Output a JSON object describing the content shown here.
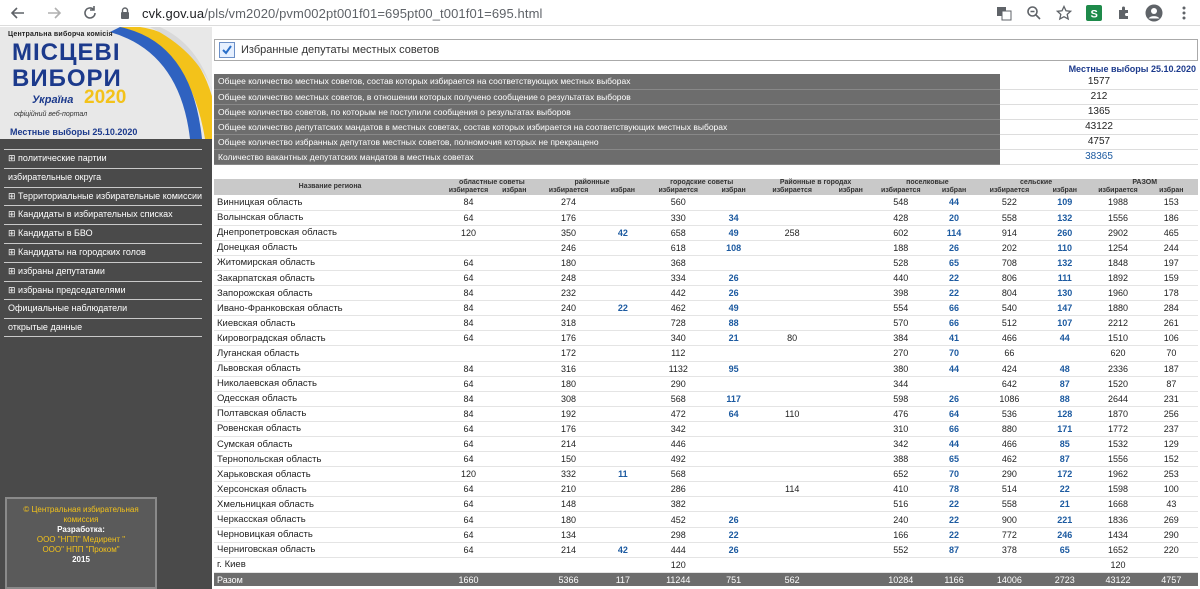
{
  "browser": {
    "url_host": "cvk.gov.ua",
    "url_path": "/pls/vm2020/pvm002pt001f01=695pt00_t001f01=695.html"
  },
  "logo": {
    "org": "Центральна виборча комісія",
    "word1": "МІСЦЕВІ",
    "word2": "ВИБОРИ",
    "country": "Україна",
    "year": "2020",
    "subtitle": "офіційний веб-портал",
    "election": "Местные выборы 25.10.2020"
  },
  "menu": [
    "⊞ политические партии",
    "избирательные округа",
    "⊞ Территориальные избирательные комиссии",
    "⊞ Кандидаты в избирательных списках",
    "⊞ Кандидаты в БВО",
    "⊞ Кандидаты на городских голов",
    "⊞ избраны депутатами",
    "⊞ избраны председателями",
    "Официальные наблюдатели",
    "открытые данные"
  ],
  "credit": {
    "line1": "© Центральная избирательная",
    "line2": "комиссия",
    "line3": "Разработка:",
    "line4": "ООО \"НПП\" Медирент \"",
    "line5": "ООО\" НПП \"Проком\"",
    "line6": "2015"
  },
  "page": {
    "title": "Избранные депутаты местных советов",
    "date_label": "Местные выборы 25.10.2020"
  },
  "summary": [
    {
      "label": "Общее количество местных советов, состав которых избирается на соответствующих местных выборах",
      "value": "1577"
    },
    {
      "label": "Общее количество местных советов, в отношении которых получено сообщение о результатах выборов",
      "value": "212"
    },
    {
      "label": "Общее количество советов, по которым не поступили сообщения о результатах выборов",
      "value": "1365"
    },
    {
      "label": "Общее количество депутатских мандатов в местных советах, состав которых избирается на соответствующих местных выборах",
      "value": "43122"
    },
    {
      "label": "Общее количество избранных депутатов местных советов, полномочия которых не прекращено",
      "value": "4757"
    },
    {
      "label": "Количество вакантных депутатских мандатов в местных советах",
      "value": "38365"
    }
  ],
  "table": {
    "header_name": "Название региона",
    "groups": [
      "областные советы",
      "районные",
      "городские советы",
      "Районные в городах",
      "поселковые",
      "сельские",
      "РАЗОМ"
    ],
    "sub_a": "избирается",
    "sub_b": "избран",
    "rows": [
      [
        "Винницкая область",
        "84",
        "",
        "274",
        "",
        "560",
        "",
        "",
        "",
        "548",
        "44",
        "522",
        "109",
        "1988",
        "153"
      ],
      [
        "Волынская область",
        "64",
        "",
        "176",
        "",
        "330",
        "34",
        "",
        "",
        "428",
        "20",
        "558",
        "132",
        "1556",
        "186"
      ],
      [
        "Днепропетровская область",
        "120",
        "",
        "350",
        "42",
        "658",
        "49",
        "258",
        "",
        "602",
        "114",
        "914",
        "260",
        "2902",
        "465"
      ],
      [
        "Донецкая область",
        "",
        "",
        "246",
        "",
        "618",
        "108",
        "",
        "",
        "188",
        "26",
        "202",
        "110",
        "1254",
        "244"
      ],
      [
        "Житомирская область",
        "64",
        "",
        "180",
        "",
        "368",
        "",
        "",
        "",
        "528",
        "65",
        "708",
        "132",
        "1848",
        "197"
      ],
      [
        "Закарпатская область",
        "64",
        "",
        "248",
        "",
        "334",
        "26",
        "",
        "",
        "440",
        "22",
        "806",
        "111",
        "1892",
        "159"
      ],
      [
        "Запорожская область",
        "84",
        "",
        "232",
        "",
        "442",
        "26",
        "",
        "",
        "398",
        "22",
        "804",
        "130",
        "1960",
        "178"
      ],
      [
        "Ивано-Франковская область",
        "84",
        "",
        "240",
        "22",
        "462",
        "49",
        "",
        "",
        "554",
        "66",
        "540",
        "147",
        "1880",
        "284"
      ],
      [
        "Киевская область",
        "84",
        "",
        "318",
        "",
        "728",
        "88",
        "",
        "",
        "570",
        "66",
        "512",
        "107",
        "2212",
        "261"
      ],
      [
        "Кировоградская область",
        "64",
        "",
        "176",
        "",
        "340",
        "21",
        "80",
        "",
        "384",
        "41",
        "466",
        "44",
        "1510",
        "106"
      ],
      [
        "Луганская область",
        "",
        "",
        "172",
        "",
        "112",
        "",
        "",
        "",
        "270",
        "70",
        "66",
        "",
        "620",
        "70"
      ],
      [
        "Львовская область",
        "84",
        "",
        "316",
        "",
        "1132",
        "95",
        "",
        "",
        "380",
        "44",
        "424",
        "48",
        "2336",
        "187"
      ],
      [
        "Николаевская область",
        "64",
        "",
        "180",
        "",
        "290",
        "",
        "",
        "",
        "344",
        "",
        "642",
        "87",
        "1520",
        "87"
      ],
      [
        "Одесская область",
        "84",
        "",
        "308",
        "",
        "568",
        "117",
        "",
        "",
        "598",
        "26",
        "1086",
        "88",
        "2644",
        "231"
      ],
      [
        "Полтавская область",
        "84",
        "",
        "192",
        "",
        "472",
        "64",
        "110",
        "",
        "476",
        "64",
        "536",
        "128",
        "1870",
        "256"
      ],
      [
        "Ровенская область",
        "64",
        "",
        "176",
        "",
        "342",
        "",
        "",
        "",
        "310",
        "66",
        "880",
        "171",
        "1772",
        "237"
      ],
      [
        "Сумская область",
        "64",
        "",
        "214",
        "",
        "446",
        "",
        "",
        "",
        "342",
        "44",
        "466",
        "85",
        "1532",
        "129"
      ],
      [
        "Тернопольская область",
        "64",
        "",
        "150",
        "",
        "492",
        "",
        "",
        "",
        "388",
        "65",
        "462",
        "87",
        "1556",
        "152"
      ],
      [
        "Харьковская область",
        "120",
        "",
        "332",
        "11",
        "568",
        "",
        "",
        "",
        "652",
        "70",
        "290",
        "172",
        "1962",
        "253"
      ],
      [
        "Херсонская область",
        "64",
        "",
        "210",
        "",
        "286",
        "",
        "114",
        "",
        "410",
        "78",
        "514",
        "22",
        "1598",
        "100"
      ],
      [
        "Хмельницкая область",
        "64",
        "",
        "148",
        "",
        "382",
        "",
        "",
        "",
        "516",
        "22",
        "558",
        "21",
        "1668",
        "43"
      ],
      [
        "Черкасская область",
        "64",
        "",
        "180",
        "",
        "452",
        "26",
        "",
        "",
        "240",
        "22",
        "900",
        "221",
        "1836",
        "269"
      ],
      [
        "Черновицкая область",
        "64",
        "",
        "134",
        "",
        "298",
        "22",
        "",
        "",
        "166",
        "22",
        "772",
        "246",
        "1434",
        "290"
      ],
      [
        "Черниговская область",
        "64",
        "",
        "214",
        "42",
        "444",
        "26",
        "",
        "",
        "552",
        "87",
        "378",
        "65",
        "1652",
        "220"
      ],
      [
        "г. Киев",
        "",
        "",
        "",
        "",
        "120",
        "",
        "",
        "",
        "",
        "",
        "",
        "",
        "120",
        ""
      ]
    ],
    "total": [
      "Разом",
      "1660",
      "",
      "5366",
      "117",
      "11244",
      "751",
      "562",
      "",
      "10284",
      "1166",
      "14006",
      "2723",
      "43122",
      "4757"
    ]
  }
}
